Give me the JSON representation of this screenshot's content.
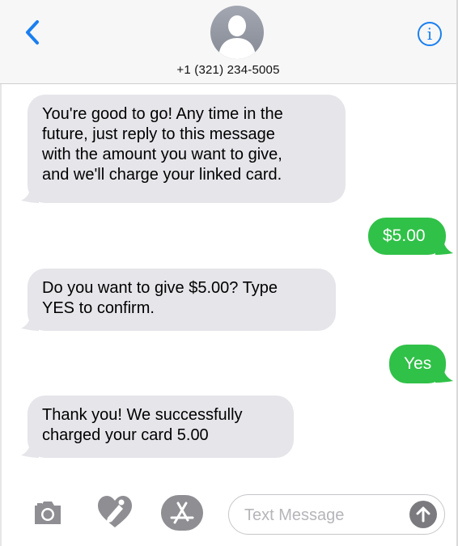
{
  "header": {
    "back_icon": "chevron-left-icon",
    "contact_avatar_icon": "person-silhouette-icon",
    "contact": "+1 (321) 234-5005",
    "info_icon": "info-circle-icon",
    "info_glyph": "i"
  },
  "colors": {
    "incoming_bubble": "#e5e5ea",
    "outgoing_bubble": "#30c148",
    "accent": "#1a7ff0"
  },
  "messages": [
    {
      "direction": "incoming",
      "lines": [
        "You're good to go! Any time in the",
        "future, just reply to this message",
        "with the amount you want to give,",
        "and we'll charge your linked card."
      ]
    },
    {
      "direction": "outgoing",
      "lines": [
        "$5.00"
      ]
    },
    {
      "direction": "incoming",
      "lines": [
        "Do you want to give $5.00? Type",
        "YES to confirm."
      ]
    },
    {
      "direction": "outgoing",
      "lines": [
        "Yes"
      ]
    },
    {
      "direction": "incoming",
      "lines": [
        "Thank you! We successfully",
        "charged your card 5.00"
      ]
    }
  ],
  "composer": {
    "camera_icon": "camera-icon",
    "digital_touch_icon": "heart-digital-touch-icon",
    "app_store_icon": "app-store-icon",
    "placeholder": "Text Message",
    "value": "",
    "send_icon": "arrow-up-icon"
  }
}
